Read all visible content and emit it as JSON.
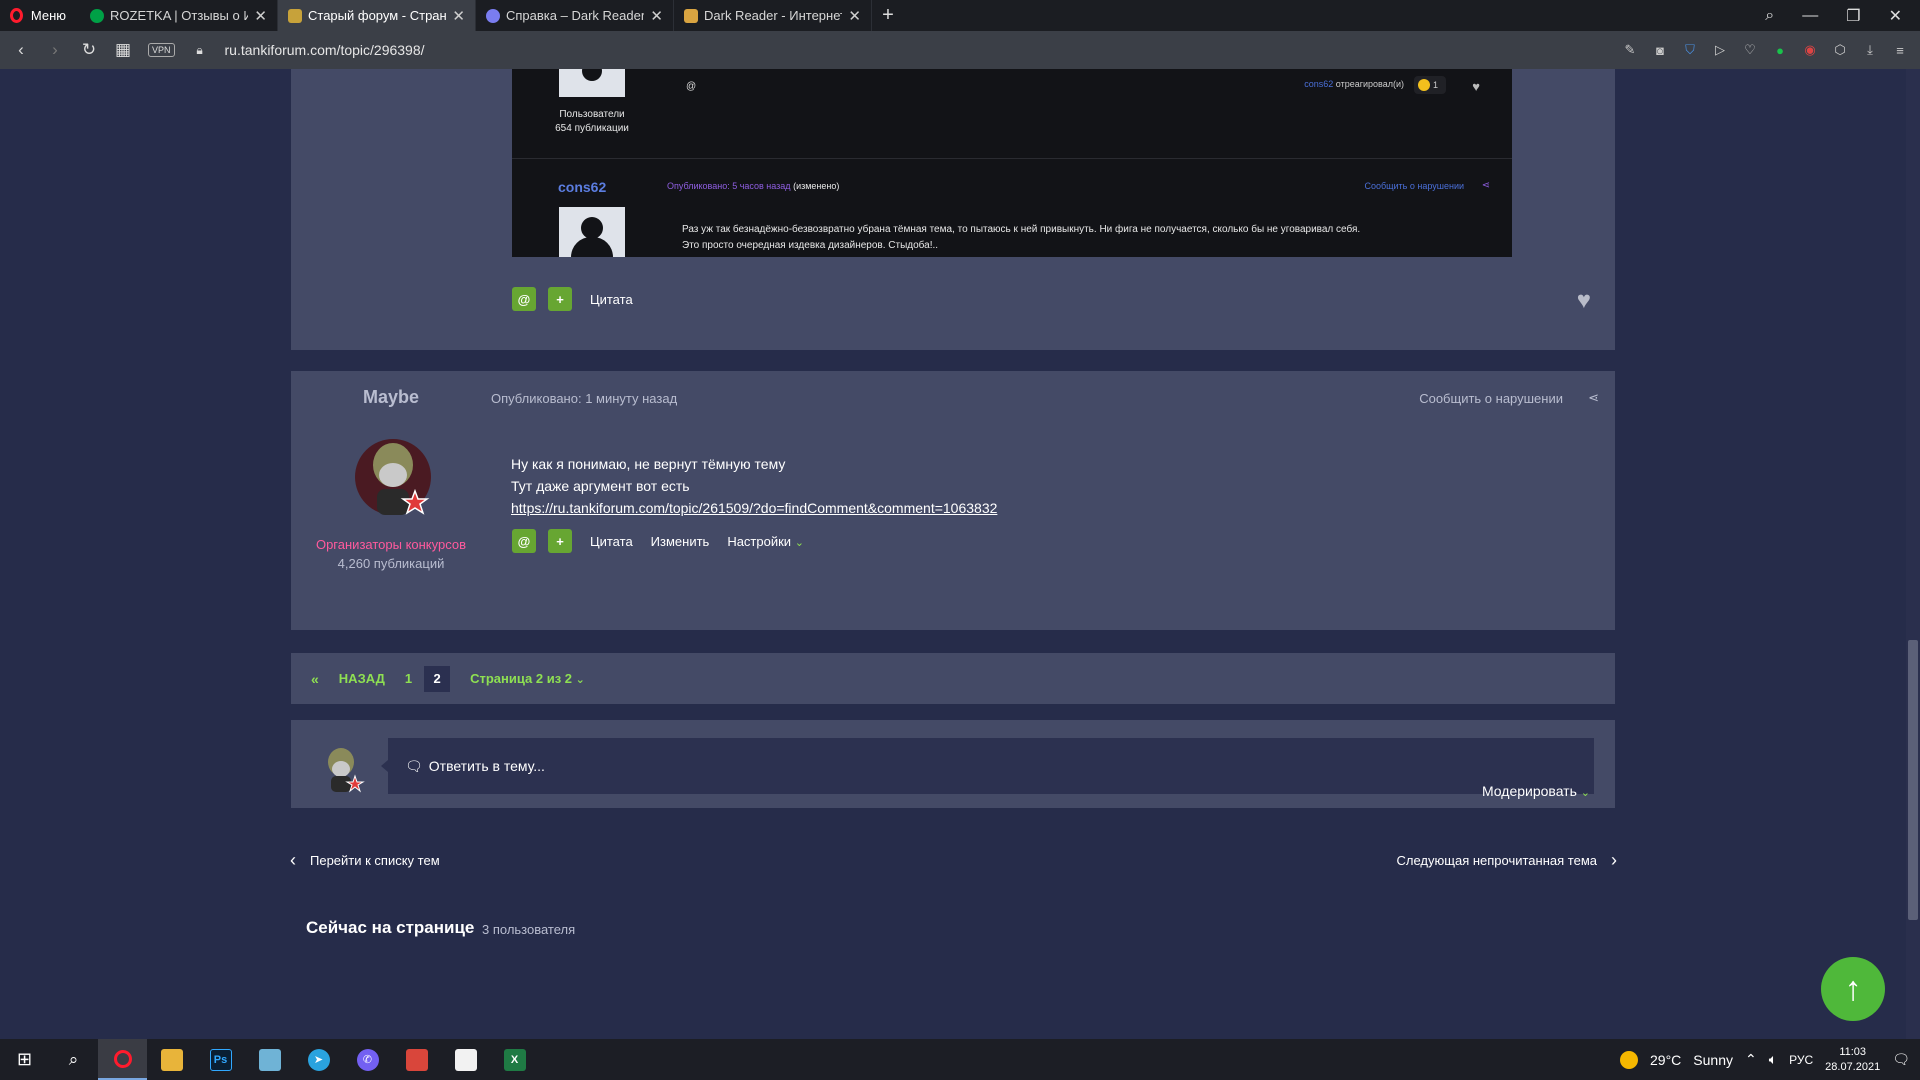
{
  "browser": {
    "menu_label": "Меню",
    "tabs": [
      {
        "title": "ROZETKA | Отзывы о Игр",
        "color": "#00a046"
      },
      {
        "title": "Старый форум - Страниц",
        "color": "#c7a23a"
      },
      {
        "title": "Справка – Dark Reader",
        "color": "#7a7df0"
      },
      {
        "title": "Dark Reader - Интернет-м",
        "color": "#d9a441"
      }
    ],
    "url": "ru.tankiforum.com/topic/296398/",
    "vpn_label": "VPN"
  },
  "quoted_screenshot": {
    "group": "Пользователи",
    "count": "654 публикации",
    "at_symbol": "@",
    "reacted_user": "cons62",
    "reacted_text": "отреагировал(и)",
    "reaction_count": "1",
    "author": "cons62",
    "posted": "Опубликовано: 5 часов назад",
    "edited": "(изменено)",
    "report": "Сообщить о нарушении",
    "text_line1": "Раз уж так безнадёжно-безвозвратно убрана тёмная тема, то пытаюсь к ней привыкнуть. Ни фига не получается, сколько бы не уговаривал себя.",
    "text_line2": "Это просто очередная издевка дизайнеров. Стыдоба!.."
  },
  "post1_actions": {
    "mention": "@",
    "plus": "+",
    "quote": "Цитата"
  },
  "post2": {
    "author": "Maybe",
    "posted": "Опубликовано: 1 минуту назад",
    "report": "Сообщить о нарушении",
    "group": "Организаторы конкурсов",
    "count": "4,260 публикаций",
    "line1": "Ну как я понимаю, не вернут тёмную тему",
    "line2": "Тут даже аргумент вот есть",
    "link": "https://ru.tankiforum.com/topic/261509/?do=findComment&comment=1063832",
    "actions": {
      "mention": "@",
      "plus": "+",
      "quote": "Цитата",
      "edit": "Изменить",
      "settings": "Настройки"
    }
  },
  "pager": {
    "first_arrow": "«",
    "back": "НАЗАД",
    "pages": [
      "1",
      "2"
    ],
    "current": "2",
    "jump": "Страница 2 из 2"
  },
  "reply": {
    "placeholder": "Ответить в тему..."
  },
  "moderate": "Модерировать",
  "nav": {
    "go_list": "Перейти к списку тем",
    "next_unread": "Следующая непрочитанная тема"
  },
  "online": {
    "title": "Сейчас на странице",
    "count": "3 пользователя"
  },
  "taskbar": {
    "weather_temp": "29°C",
    "weather_desc": "Sunny",
    "lang": "РУС",
    "time": "11:03",
    "date": "28.07.2021"
  },
  "colors": {
    "accent_green": "#67a632",
    "link_green": "#8ee052",
    "group_pink": "#ff5a9d",
    "page_bg": "#262c4a",
    "card_bg": "#444a66"
  }
}
